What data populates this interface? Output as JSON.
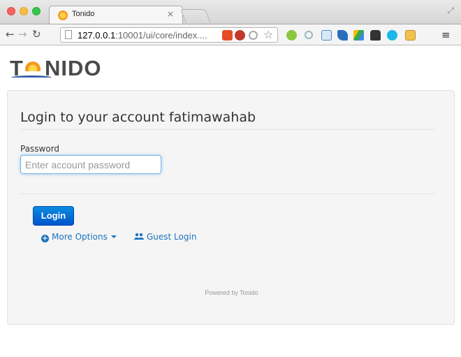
{
  "browser": {
    "tab_title": "Tonido",
    "tab_close": "×",
    "url_host": "127.0.0.1",
    "url_rest": ":10001/ui/core/index....",
    "icons": [
      "close-window-icon",
      "minimize-window-icon",
      "zoom-window-icon",
      "back-icon",
      "forward-icon",
      "reload-icon",
      "page-icon",
      "html5-icon",
      "adblock-icon",
      "clip-icon",
      "bookmark-star-icon",
      "green-extension-icon",
      "search-extension-icon",
      "bookmarks-extension-icon",
      "bird-extension-icon",
      "drive-icon",
      "ghostery-icon",
      "chat-icon",
      "clipboard-icon",
      "menu-icon"
    ]
  },
  "logo": {
    "text_left": "T",
    "text_right": "NIDO"
  },
  "login": {
    "title": "Login to your account fatimawahab",
    "password_label": "Password",
    "password_placeholder": "Enter account password",
    "password_value": "",
    "login_button": "Login",
    "more_options": "More Options",
    "guest_login": "Guest Login",
    "powered_by": "Powered by Tonido"
  },
  "colors": {
    "accent": "#0a6fd6",
    "link": "#1a73c0",
    "card_bg": "#f5f5f5",
    "logo_text": "#4a4a4a",
    "logo_sun": "#f39a1e"
  }
}
